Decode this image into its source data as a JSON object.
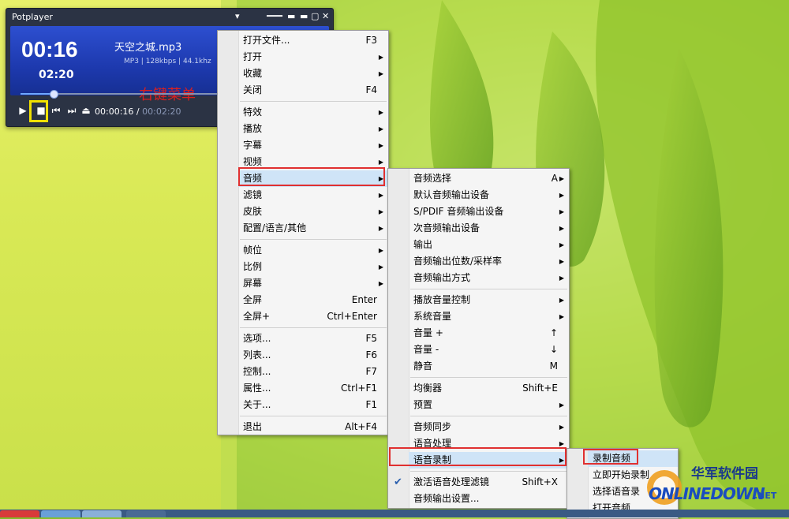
{
  "player": {
    "app_title": "Potplayer",
    "elapsed_big": "00:16",
    "total_small": "02:20",
    "track_name": "天空之城.mp3",
    "format": "MP3",
    "bitrate": "128kbps",
    "samplerate": "44.1khz",
    "annotation": "右键菜单",
    "time_elapsed": "00:00:16",
    "time_separator": "/",
    "time_total": "00:02:20",
    "progress_fraction": 0.11
  },
  "main_menu": [
    {
      "label": "打开文件...",
      "shortcut": "F3"
    },
    {
      "label": "打开",
      "shortcut": ""
    },
    {
      "label": "收藏",
      "shortcut": ""
    },
    {
      "label": "关闭",
      "shortcut": "F4"
    },
    {
      "label": "特效",
      "shortcut": ""
    },
    {
      "label": "播放",
      "shortcut": ""
    },
    {
      "label": "字幕",
      "shortcut": ""
    },
    {
      "label": "视频",
      "shortcut": ""
    },
    {
      "label": "音频",
      "shortcut": ""
    },
    {
      "label": "滤镜",
      "shortcut": ""
    },
    {
      "label": "皮肤",
      "shortcut": ""
    },
    {
      "label": "配置/语言/其他",
      "shortcut": ""
    },
    {
      "label": "帧位",
      "shortcut": ""
    },
    {
      "label": "比例",
      "shortcut": ""
    },
    {
      "label": "屏幕",
      "shortcut": ""
    },
    {
      "label": "全屏",
      "shortcut": "Enter"
    },
    {
      "label": "全屏+",
      "shortcut": "Ctrl+Enter"
    },
    {
      "label": "选项...",
      "shortcut": "F5"
    },
    {
      "label": "列表...",
      "shortcut": "F6"
    },
    {
      "label": "控制...",
      "shortcut": "F7"
    },
    {
      "label": "属性...",
      "shortcut": "Ctrl+F1"
    },
    {
      "label": "关于...",
      "shortcut": "F1"
    },
    {
      "label": "退出",
      "shortcut": "Alt+F4"
    }
  ],
  "audio_menu": [
    {
      "label": "音频选择",
      "shortcut": "A"
    },
    {
      "label": "默认音频输出设备",
      "shortcut": ""
    },
    {
      "label": "S/PDIF 音频输出设备",
      "shortcut": ""
    },
    {
      "label": "次音频输出设备",
      "shortcut": ""
    },
    {
      "label": "输出",
      "shortcut": ""
    },
    {
      "label": "音频输出位数/采样率",
      "shortcut": ""
    },
    {
      "label": "音频输出方式",
      "shortcut": ""
    },
    {
      "label": "播放音量控制",
      "shortcut": ""
    },
    {
      "label": "系统音量",
      "shortcut": ""
    },
    {
      "label": "音量 +",
      "shortcut": "↑"
    },
    {
      "label": "音量 -",
      "shortcut": "↓"
    },
    {
      "label": "静音",
      "shortcut": "M"
    },
    {
      "label": "均衡器",
      "shortcut": "Shift+E"
    },
    {
      "label": "预置",
      "shortcut": ""
    },
    {
      "label": "音频同步",
      "shortcut": ""
    },
    {
      "label": "语音处理",
      "shortcut": ""
    },
    {
      "label": "语音录制",
      "shortcut": ""
    },
    {
      "label": "激活语音处理滤镜",
      "shortcut": "Shift+X"
    },
    {
      "label": "音频输出设置...",
      "shortcut": ""
    }
  ],
  "record_menu": [
    {
      "label": "录制音频"
    },
    {
      "label": "立即开始录制"
    },
    {
      "label": "选择语音录"
    },
    {
      "label": "打开音频"
    }
  ],
  "watermark": {
    "cn": "华军软件园",
    "en": "ONLINEDOWN",
    "suffix": ".NET"
  },
  "colors": {
    "highlight_red": "#e03030",
    "stop_highlight": "#f0e000",
    "menu_hover": "#cfe4f7"
  }
}
